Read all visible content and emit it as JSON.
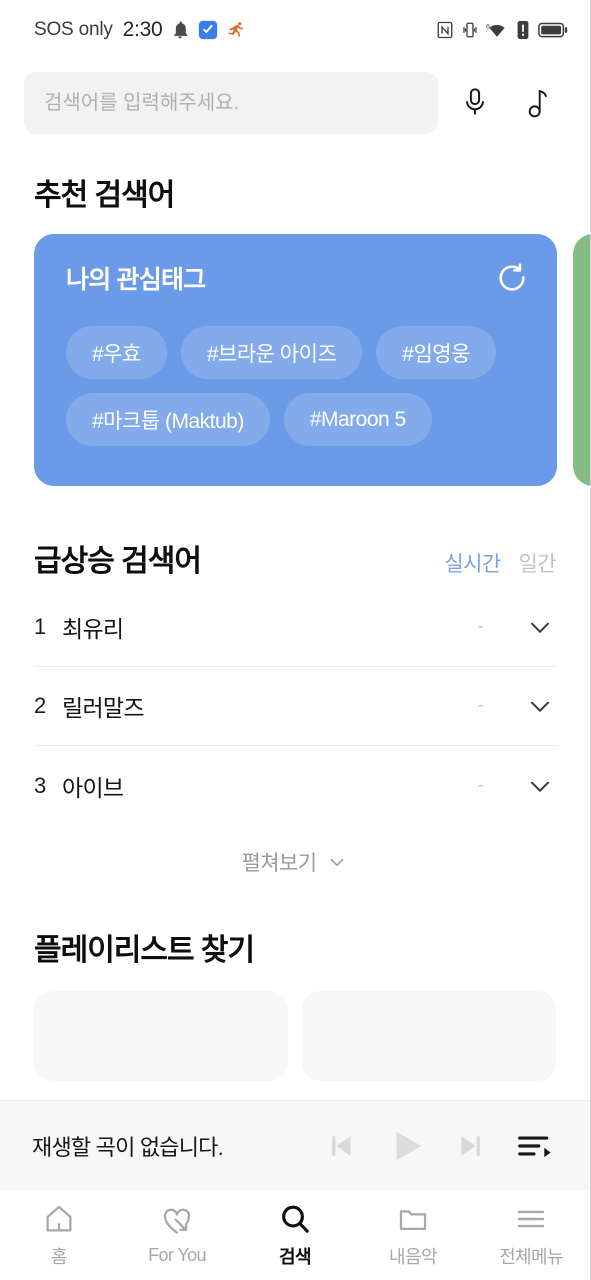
{
  "statusbar": {
    "carrier": "SOS only",
    "time": "2:30",
    "left_icons": [
      "bell-icon",
      "app-badge-icon",
      "running-person-icon"
    ],
    "right_icons": [
      "nfc-icon",
      "vibrate-icon",
      "wifi6-icon",
      "alert-icon",
      "battery-icon"
    ]
  },
  "search": {
    "placeholder": "검색어를 입력해주세요.",
    "value": "",
    "mic_icon": "microphone-icon",
    "music_icon": "music-note-icon"
  },
  "suggested": {
    "heading": "추천 검색어",
    "card": {
      "title": "나의 관심태그",
      "refresh_icon": "refresh-icon",
      "color": "#6b9ae8",
      "chip_color": "#83abec",
      "tags": [
        "#우효",
        "#브라운 아이즈",
        "#임영웅",
        "#마크툽 (Maktub)",
        "#Maroon 5"
      ]
    },
    "next_card_color": "#85bd85"
  },
  "trending": {
    "heading": "급상승 검색어",
    "tabs": [
      {
        "label": "실시간",
        "active": true
      },
      {
        "label": "일간",
        "active": false
      }
    ],
    "active_tab_color": "#7ba3e0",
    "rows": [
      {
        "rank": "1",
        "name": "최유리",
        "change": "-"
      },
      {
        "rank": "2",
        "name": "릴러말즈",
        "change": "-"
      },
      {
        "rank": "3",
        "name": "아이브",
        "change": "-"
      }
    ],
    "expand_label": "펼쳐보기"
  },
  "playlist": {
    "heading": "플레이리스트 찾기"
  },
  "player": {
    "text": "재생할 곡이 없습니다.",
    "prev_icon": "skip-previous-icon",
    "play_icon": "play-icon",
    "next_icon": "skip-next-icon",
    "queue_icon": "playlist-queue-icon"
  },
  "nav": [
    {
      "label": "홈",
      "icon": "home-icon",
      "active": false
    },
    {
      "label": "For You",
      "icon": "heart-arrow-icon",
      "active": false
    },
    {
      "label": "검색",
      "icon": "search-icon",
      "active": true
    },
    {
      "label": "내음악",
      "icon": "folder-icon",
      "active": false
    },
    {
      "label": "전체메뉴",
      "icon": "hamburger-menu-icon",
      "active": false
    }
  ]
}
